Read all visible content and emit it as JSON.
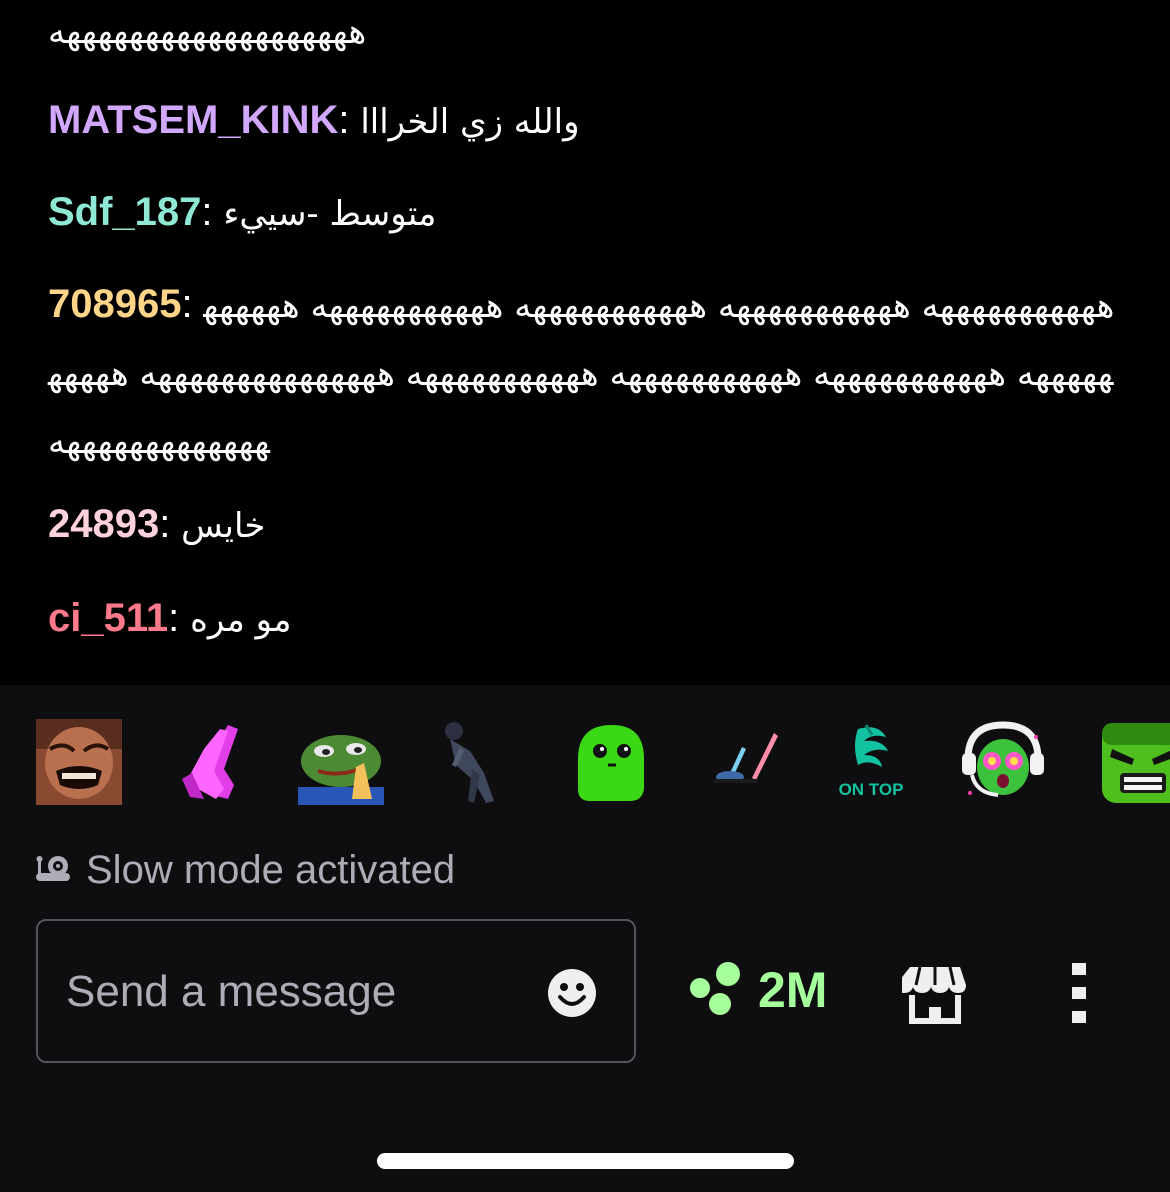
{
  "chat": {
    "top_fragment": "هههههههههههههههههههه",
    "messages": [
      {
        "user": "MATSEM_KINK",
        "user_color": "#d2a8ff",
        "text": "والله زي الخرااا"
      },
      {
        "user": "Sdf_187",
        "user_color": "#8ee8d4",
        "text": "متوسط -سييء"
      },
      {
        "user": "708965",
        "user_color": "#ffd58a",
        "text": "هههههههههههه هههههههههههه هههههههههههه هههههههههههه هههههههههههه هههههههههههه هههههههههههه هههههههههههه هههههههههههههههه ههههههههههههههههههه"
      },
      {
        "user": "24893",
        "user_color": "#ffd1dc",
        "text": "خايس"
      },
      {
        "user": "ci_511",
        "user_color": "#ff7a8a",
        "text": "مو مره"
      }
    ],
    "separator": ":"
  },
  "emotes": [
    {
      "name": "laughing-man-emote"
    },
    {
      "name": "pink-praying-hands-emote"
    },
    {
      "name": "pepe-pray-emote"
    },
    {
      "name": "man-bowing-emote"
    },
    {
      "name": "green-blob-emote"
    },
    {
      "name": "brush-painting-emote"
    },
    {
      "name": "on-top-logo-emote",
      "caption": "ON TOP"
    },
    {
      "name": "green-gamer-headset-emote"
    },
    {
      "name": "angry-green-face-emote"
    }
  ],
  "slow_mode": {
    "icon": "snail-icon",
    "label": "Slow mode activated"
  },
  "composer": {
    "placeholder": "Send a message",
    "emoji_icon": "smiley-icon"
  },
  "channel_points": {
    "icon": "channel-points-icon",
    "value": "2M"
  },
  "toolbar": {
    "store_icon": "store-icon",
    "more_icon": "more-vertical-icon"
  },
  "colors": {
    "chat_bg": "#000000",
    "panel_bg": "#0e0e10",
    "points_green": "#a5ff9b",
    "muted_text": "#adadb8"
  }
}
